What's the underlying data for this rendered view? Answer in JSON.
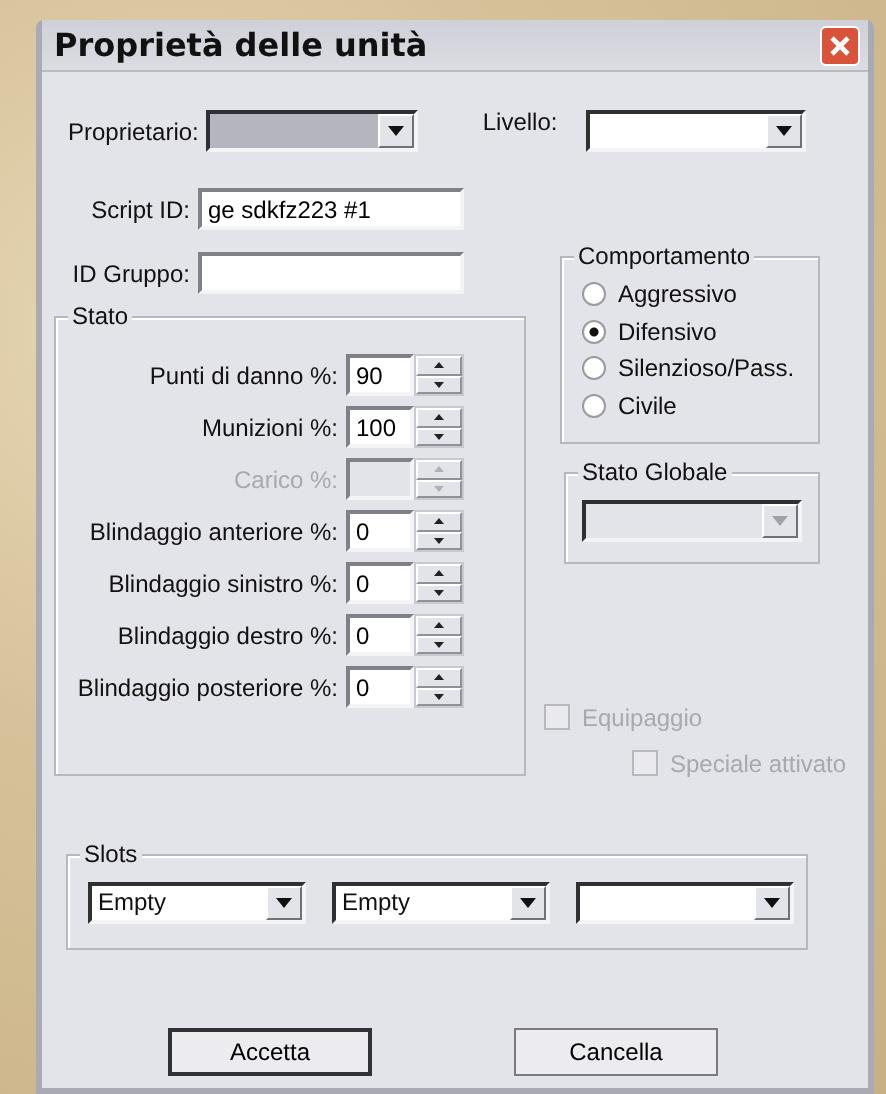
{
  "window": {
    "title": "Proprietà delle unità"
  },
  "owner": {
    "label": "Proprietario:",
    "readonly": true
  },
  "rank": {
    "label": "Livello:"
  },
  "script_id": {
    "label": "Script ID:",
    "value": "ge sdkfz223 #1"
  },
  "group_id": {
    "label": "ID Gruppo:"
  },
  "status": {
    "title": "Stato",
    "fields": [
      {
        "label": "Punti di danno %:",
        "value": "90",
        "disabled": false
      },
      {
        "label": "Munizioni %:",
        "value": "100",
        "disabled": false
      },
      {
        "label": "Carico %:",
        "disabled": true
      },
      {
        "label": "Blindaggio anteriore %:",
        "value": "0",
        "disabled": false
      },
      {
        "label": "Blindaggio sinistro %:",
        "value": "0",
        "disabled": false
      },
      {
        "label": "Blindaggio destro %:",
        "value": "0",
        "disabled": false
      },
      {
        "label": "Blindaggio posteriore %:",
        "value": "0",
        "disabled": false
      }
    ]
  },
  "behaviour": {
    "title": "Comportamento",
    "options": [
      {
        "label": "Aggressivo",
        "selected": false
      },
      {
        "label": "Difensivo",
        "selected": true
      },
      {
        "label": "Silenzioso/Pass.",
        "selected": false
      },
      {
        "label": "Civile",
        "selected": false
      }
    ]
  },
  "global_state": {
    "title": "Stato Globale",
    "disabled": true
  },
  "checkboxes": [
    {
      "label": "Equipaggio",
      "checked": false,
      "disabled": true,
      "kind": "main"
    },
    {
      "label": "Speciale attivato",
      "checked": false,
      "disabled": true,
      "kind": "sub"
    }
  ],
  "slots": {
    "title": "Slots",
    "items": [
      {
        "kind": "filled",
        "value": "Empty"
      },
      {
        "kind": "filled",
        "value": "Empty"
      },
      {
        "kind": "blank"
      }
    ]
  },
  "buttons": [
    {
      "label": "Accetta",
      "default": true
    },
    {
      "label": "Cancella",
      "default": false
    }
  ]
}
